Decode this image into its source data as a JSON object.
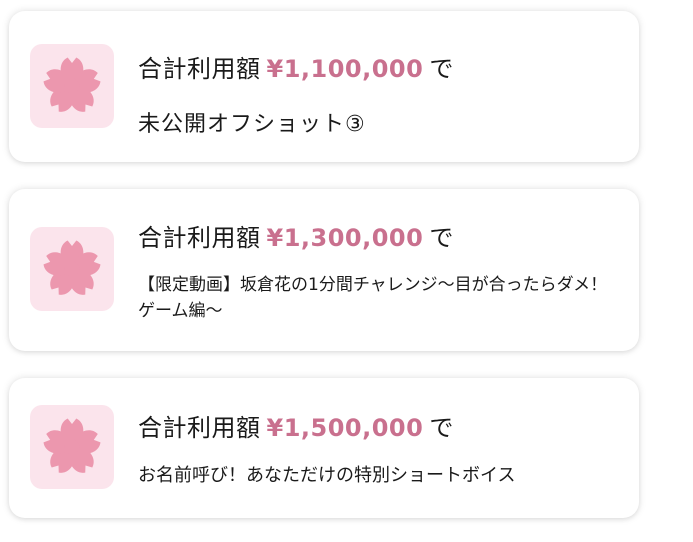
{
  "tiers": [
    {
      "label": "合計利用額",
      "amount": "¥1,100,000",
      "suffix": "で",
      "reward": "未公開オフショット③"
    },
    {
      "label": "合計利用額",
      "amount": "¥1,300,000",
      "suffix": "で",
      "reward": "【限定動画】坂倉花の1分間チャレンジ〜目が合ったらダメ！ゲーム編〜"
    },
    {
      "label": "合計利用額",
      "amount": "¥1,500,000",
      "suffix": "で",
      "reward": "お名前呼び！あなただけの特別ショートボイス"
    }
  ],
  "colors": {
    "accent": "#c9708e",
    "icon_background": "#fbe4ec",
    "flower": "#ec97ae",
    "text": "#1a1a1a"
  },
  "icon": "sakura-icon"
}
